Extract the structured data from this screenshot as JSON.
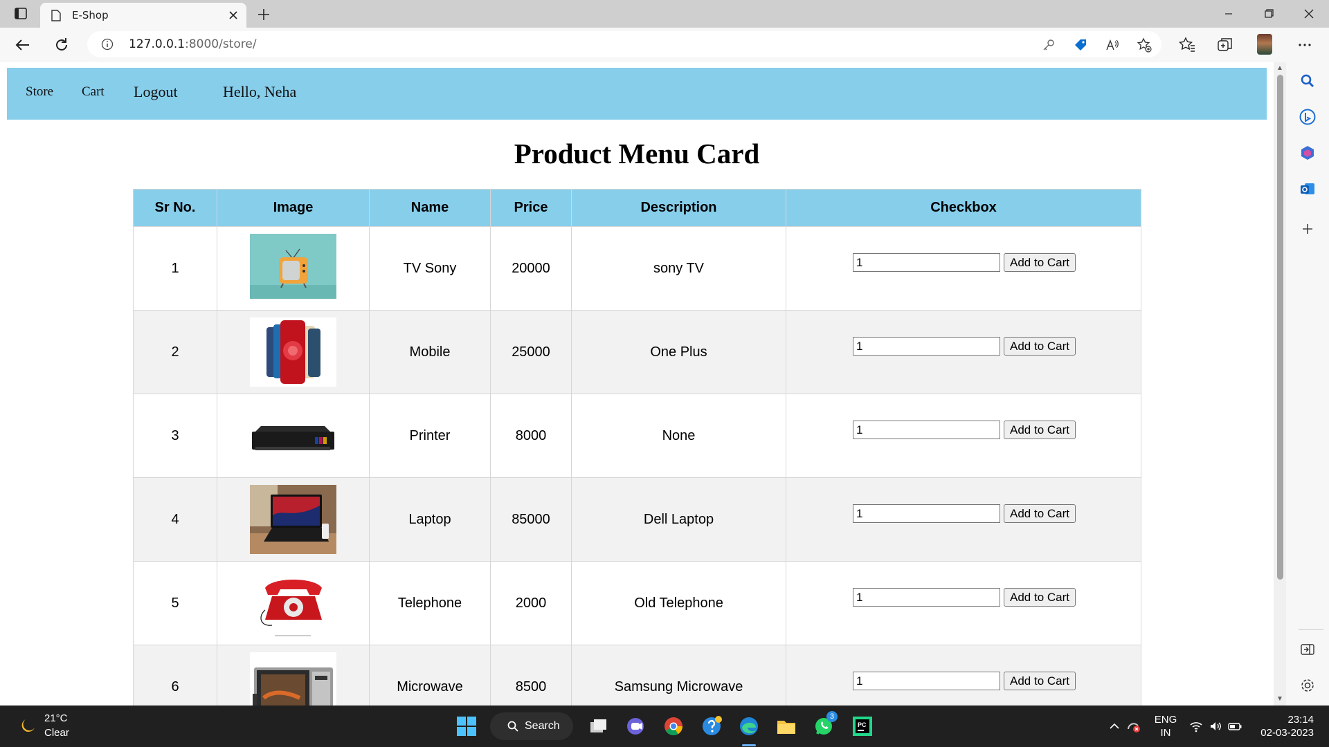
{
  "browser": {
    "tab_title": "E-Shop",
    "url_host": "127.0.0.1",
    "url_rest": ":8000/store/"
  },
  "nav": {
    "store": "Store",
    "cart": "Cart",
    "logout": "Logout",
    "greeting": "Hello, Neha"
  },
  "page": {
    "title": "Product Menu Card"
  },
  "table": {
    "headers": [
      "Sr No.",
      "Image",
      "Name",
      "Price",
      "Description",
      "Checkbox"
    ],
    "rows": [
      {
        "sr": "1",
        "image": "tv-image",
        "name": "TV Sony",
        "price": "20000",
        "description": "sony TV",
        "qty": "1",
        "button": "Add to Cart"
      },
      {
        "sr": "2",
        "image": "mobile-image",
        "name": "Mobile",
        "price": "25000",
        "description": "One Plus",
        "qty": "1",
        "button": "Add to Cart"
      },
      {
        "sr": "3",
        "image": "printer-image",
        "name": "Printer",
        "price": "8000",
        "description": "None",
        "qty": "1",
        "button": "Add to Cart"
      },
      {
        "sr": "4",
        "image": "laptop-image",
        "name": "Laptop",
        "price": "85000",
        "description": "Dell Laptop",
        "qty": "1",
        "button": "Add to Cart"
      },
      {
        "sr": "5",
        "image": "telephone-image",
        "name": "Telephone",
        "price": "2000",
        "description": "Old Telephone",
        "qty": "1",
        "button": "Add to Cart"
      },
      {
        "sr": "6",
        "image": "microwave-image",
        "name": "Microwave",
        "price": "8500",
        "description": "Samsung Microwave",
        "qty": "1",
        "button": "Add to Cart"
      }
    ]
  },
  "taskbar": {
    "temperature": "21°C",
    "condition": "Clear",
    "search_label": "Search",
    "whatsapp_badge": "3",
    "lang_line1": "ENG",
    "lang_line2": "IN",
    "time": "23:14",
    "date": "02-03-2023"
  },
  "colors": {
    "navbar": "#87ceeb",
    "header_row": "#87ceeb",
    "alt_row": "#f2f2f2",
    "taskbar": "#202020"
  }
}
